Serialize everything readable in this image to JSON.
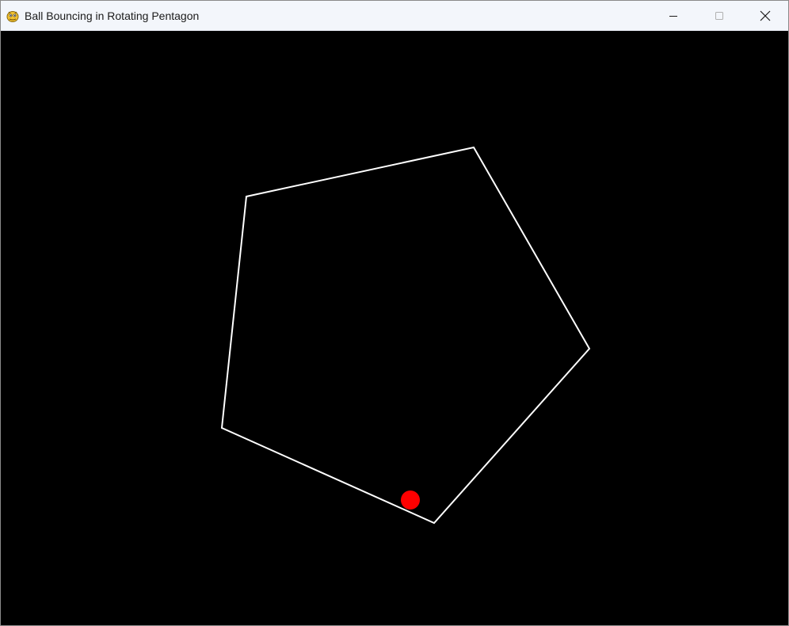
{
  "window": {
    "title": "Ball Bouncing in Rotating Pentagon",
    "app_icon": "pygame-snake-icon",
    "controls": {
      "minimize": "minimize-icon",
      "maximize": "maximize-icon",
      "close": "close-icon"
    }
  },
  "scene": {
    "background_color": "#000000",
    "pentagon": {
      "stroke_color": "#ffffff"
    },
    "ball": {
      "fill_color": "#ff0000"
    }
  }
}
